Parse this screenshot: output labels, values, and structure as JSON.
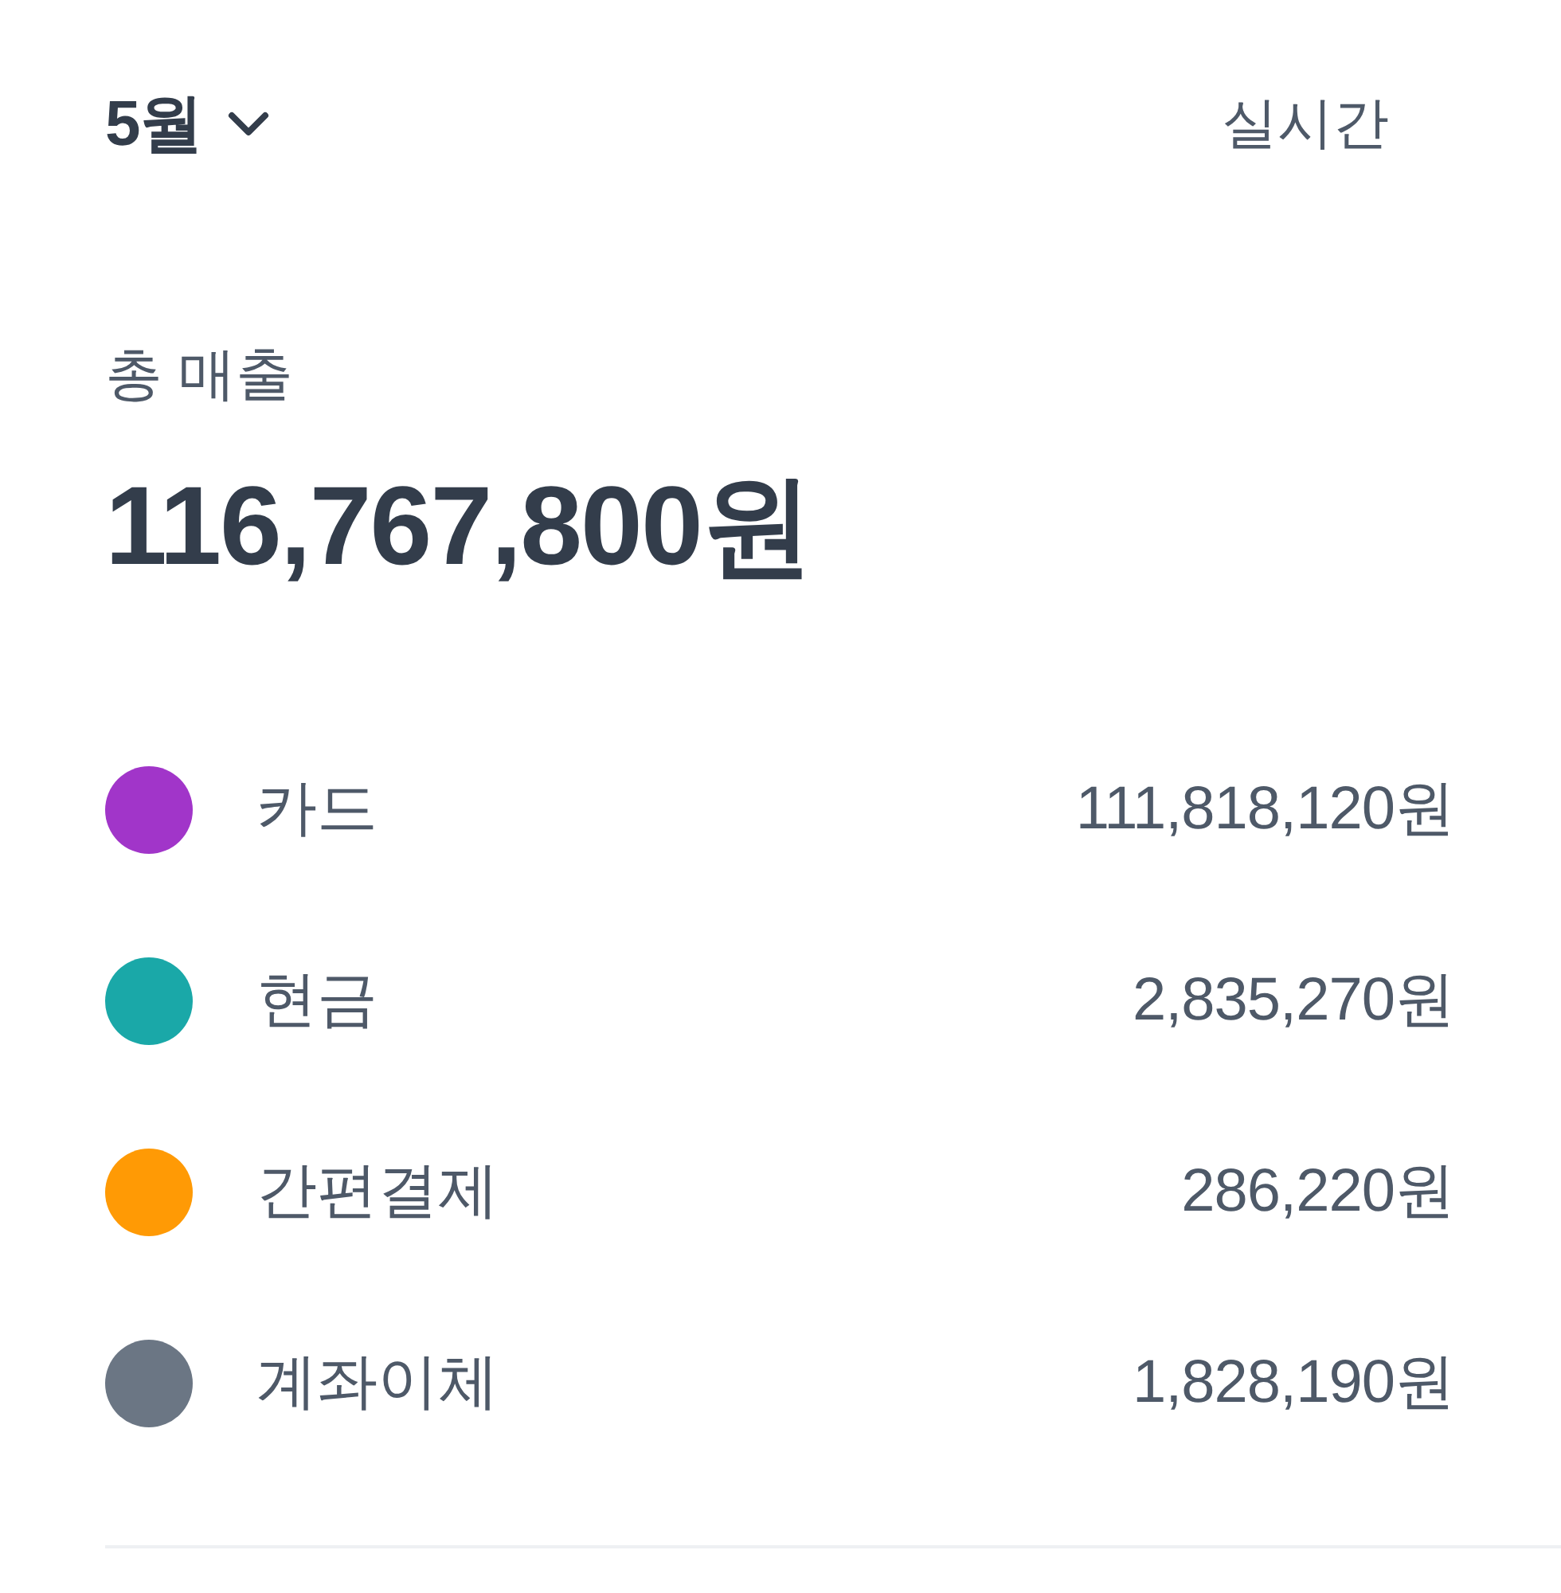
{
  "header": {
    "month": "5월",
    "realtime": "실시간"
  },
  "summary": {
    "label": "총 매출",
    "total": "116,767,800원"
  },
  "payment_methods": [
    {
      "name": "카드",
      "amount": "111,818,120원",
      "color": "#a135c9"
    },
    {
      "name": "현금",
      "amount": "2,835,270원",
      "color": "#1aa8a8"
    },
    {
      "name": "간편결제",
      "amount": "286,220원",
      "color": "#ff9a05"
    },
    {
      "name": "계좌이체",
      "amount": "1,828,190원",
      "color": "#6b7684"
    }
  ]
}
